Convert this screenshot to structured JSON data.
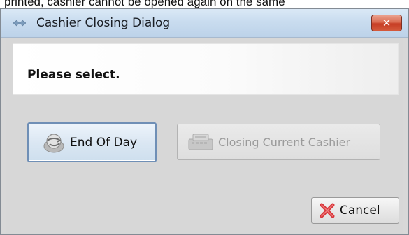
{
  "background": {
    "text": "printed, cashier cannot be opened again on the same"
  },
  "dialog": {
    "title": "Cashier Closing Dialog",
    "close_glyph": "✕",
    "message": "Please select.",
    "buttons": {
      "end_of_day": {
        "label": "End Of Day",
        "icon": "end-of-day-icon"
      },
      "closing_current_cashier": {
        "label": "Closing Current Cashier",
        "icon": "cash-register-icon",
        "disabled": true
      },
      "cancel": {
        "label": "Cancel",
        "icon": "cancel-x-icon"
      }
    }
  },
  "colors": {
    "titlebar": "#c9dcef",
    "close_button": "#d45a3c",
    "dialog_bg": "#d8d8d8",
    "focused_border": "#6f8fb6",
    "cancel_x": "#d8353a"
  }
}
